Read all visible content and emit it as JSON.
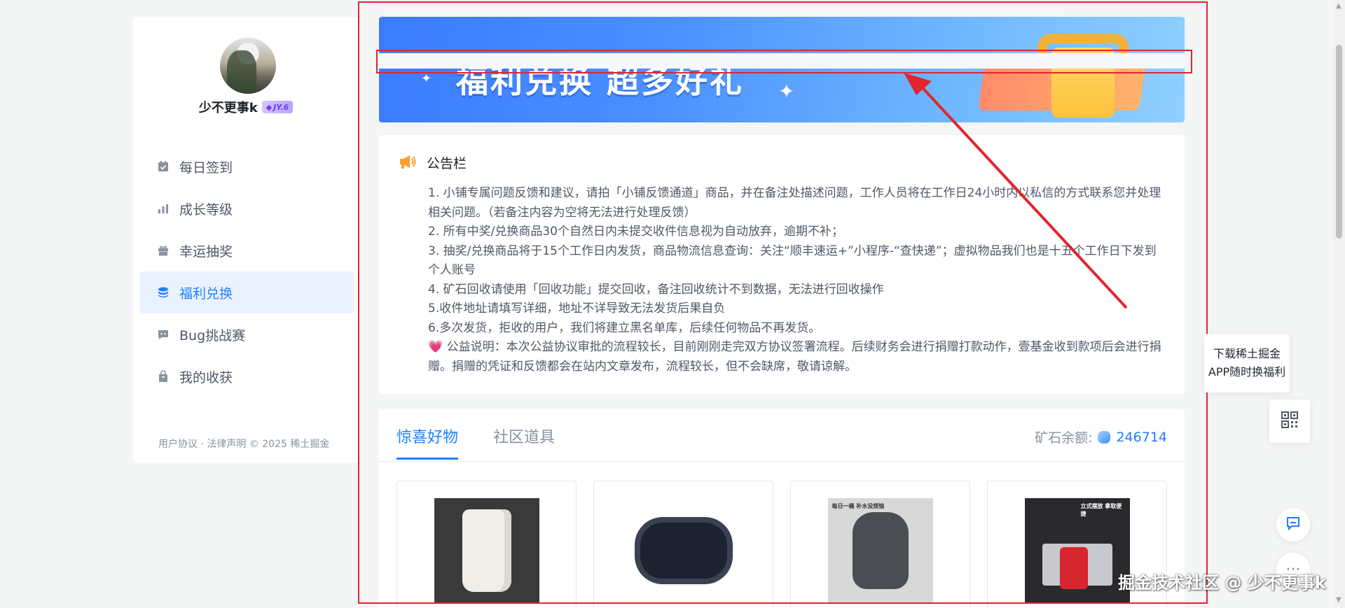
{
  "user": {
    "name": "少不更事k",
    "level": "JY.6"
  },
  "sidebar": {
    "items": [
      {
        "label": "每日签到",
        "icon": "calendar-check-icon"
      },
      {
        "label": "成长等级",
        "icon": "bar-chart-icon"
      },
      {
        "label": "幸运抽奖",
        "icon": "gift-icon"
      },
      {
        "label": "福利兑换",
        "icon": "database-coins-icon",
        "active": true
      },
      {
        "label": "Bug挑战赛",
        "icon": "bug-chat-icon"
      },
      {
        "label": "我的收获",
        "icon": "bag-icon"
      }
    ],
    "footer": {
      "user_agreement": "用户协议",
      "separator": " · ",
      "legal": "法律声明",
      "copyright": " © 2025 稀土掘金"
    }
  },
  "banner": {
    "title": "福利兑换 超多好礼"
  },
  "notice": {
    "title": "公告栏",
    "lines": [
      "1. 小铺专属问题反馈和建议，请拍「小铺反馈通道」商品，并在备注处描述问题，工作人员将在工作日24小时内以私信的方式联系您并处理相关问题。（若备注内容为空将无法进行处理反馈）",
      "2. 所有中奖/兑换商品30个自然日内未提交收件信息视为自动放弃，逾期不补；",
      "3. 抽奖/兑换商品将于15个工作日内发货，商品物流信息查询：关注“顺丰速运+”小程序-“查快递”；虚拟物品我们也是十五个工作日下发到个人账号",
      "4. 矿石回收请使用「回收功能」提交回收，备注回收统计不到数据，无法进行回收操作",
      "5.收件地址请填写详细，地址不详导致无法发货后果自负",
      "6.多次发货，拒收的用户，我们将建立黑名单库，后续任何物品不再发货。",
      "💗 公益说明：本次公益协议审批的流程较长，目前刚刚走完双方协议签署流程。后续财务会进行捐赠打款动作，壹基金收到款项后会进行捐赠。捐赠的凭证和反馈都会在站内文章发布，流程较长，但不会缺席，敬请谅解。"
    ]
  },
  "shop": {
    "tabs": [
      "惊喜好物",
      "社区道具"
    ],
    "active_tab": 0,
    "balance_label": "矿石余额:",
    "balance_value": "246714",
    "products": [
      {
        "caption": ""
      },
      {
        "caption": ""
      },
      {
        "caption": "每日一桶 补水没烦恼"
      },
      {
        "caption": "立式摆放 拿取便捷"
      }
    ]
  },
  "float": {
    "download_line1": "下载稀土掘金",
    "download_line2": "APP随时换福利",
    "watermark": "掘金技术社区 @ 少不更事k"
  },
  "colors": {
    "accent": "#1e80ff",
    "annotation": "#e0262e",
    "active_bg": "#eaf2ff"
  }
}
